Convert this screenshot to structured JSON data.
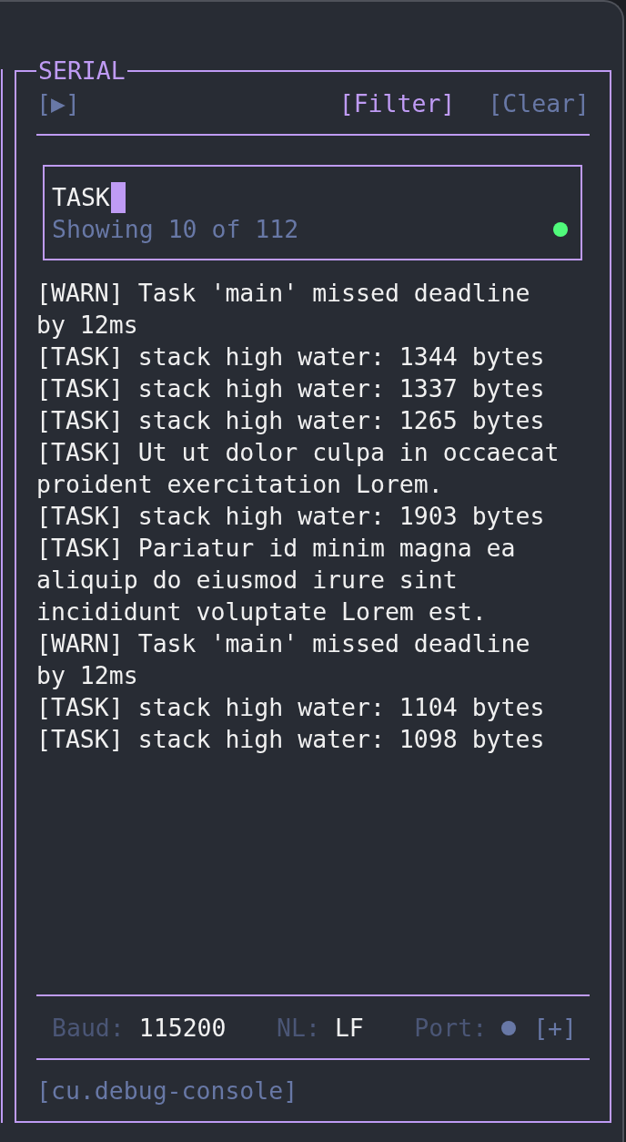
{
  "panel": {
    "title": "SERIAL"
  },
  "toolbar": [
    {
      "label": "[▶]",
      "selected": false
    },
    {
      "label": "[Filter]",
      "selected": true
    },
    {
      "label": "[Clear]",
      "selected": false
    }
  ],
  "filter": {
    "value": "TASK",
    "focused": true,
    "status": "Showing 10 of 112",
    "match": true
  },
  "log": [
    "[WARN] Task 'main' missed deadline by 12ms",
    "[TASK] stack high water: 1344 bytes",
    "[TASK] stack high water: 1337 bytes",
    "[TASK] stack high water: 1265 bytes",
    "[TASK] Ut ut dolor culpa in occaecat proident exercitation Lorem.",
    "[TASK] stack high water: 1903 bytes",
    "[TASK] Pariatur id minim magna ea aliquip do eiusmod irure sint incididunt voluptate Lorem est.",
    "[WARN] Task 'main' missed deadline by 12ms",
    "[TASK] stack high water: 1104 bytes",
    "[TASK] stack high water: 1098 bytes"
  ],
  "status_bar": {
    "baud": {
      "label": "Baud:",
      "value": "115200"
    },
    "newline": {
      "label": "NL:",
      "value": "LF"
    },
    "port": {
      "label": "Port:",
      "connected": false,
      "action": "[+]"
    }
  },
  "footer": "[cu.debug-console]"
}
